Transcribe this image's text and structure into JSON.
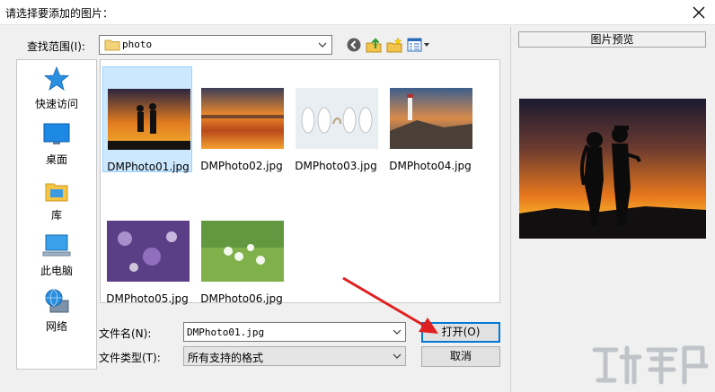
{
  "window": {
    "title": "请选择要添加的图片："
  },
  "toolbar": {
    "look_in_label": "查找范围(I):",
    "look_in_value": "photo"
  },
  "places": [
    {
      "label": "快速访问",
      "icon": "star-icon"
    },
    {
      "label": "桌面",
      "icon": "desktop-icon"
    },
    {
      "label": "库",
      "icon": "library-icon"
    },
    {
      "label": "此电脑",
      "icon": "computer-icon"
    },
    {
      "label": "网络",
      "icon": "network-icon"
    }
  ],
  "files": [
    {
      "name": "DMPhoto01.jpg",
      "selected": true
    },
    {
      "name": "DMPhoto02.jpg",
      "selected": false
    },
    {
      "name": "DMPhoto03.jpg",
      "selected": false
    },
    {
      "name": "DMPhoto04.jpg",
      "selected": false
    },
    {
      "name": "DMPhoto05.jpg",
      "selected": false
    },
    {
      "name": "DMPhoto06.jpg",
      "selected": false
    }
  ],
  "form": {
    "filename_label": "文件名(N):",
    "filename_value": "DMPhoto01.jpg",
    "filetype_label": "文件类型(T):",
    "filetype_value": "所有支持的格式"
  },
  "buttons": {
    "open": "打开(O)",
    "cancel": "取消"
  },
  "preview": {
    "label": "图片预览"
  },
  "colors": {
    "selection": "#cce8ff",
    "default_button_border": "#0078d7",
    "annotation_arrow": "#e02020"
  }
}
